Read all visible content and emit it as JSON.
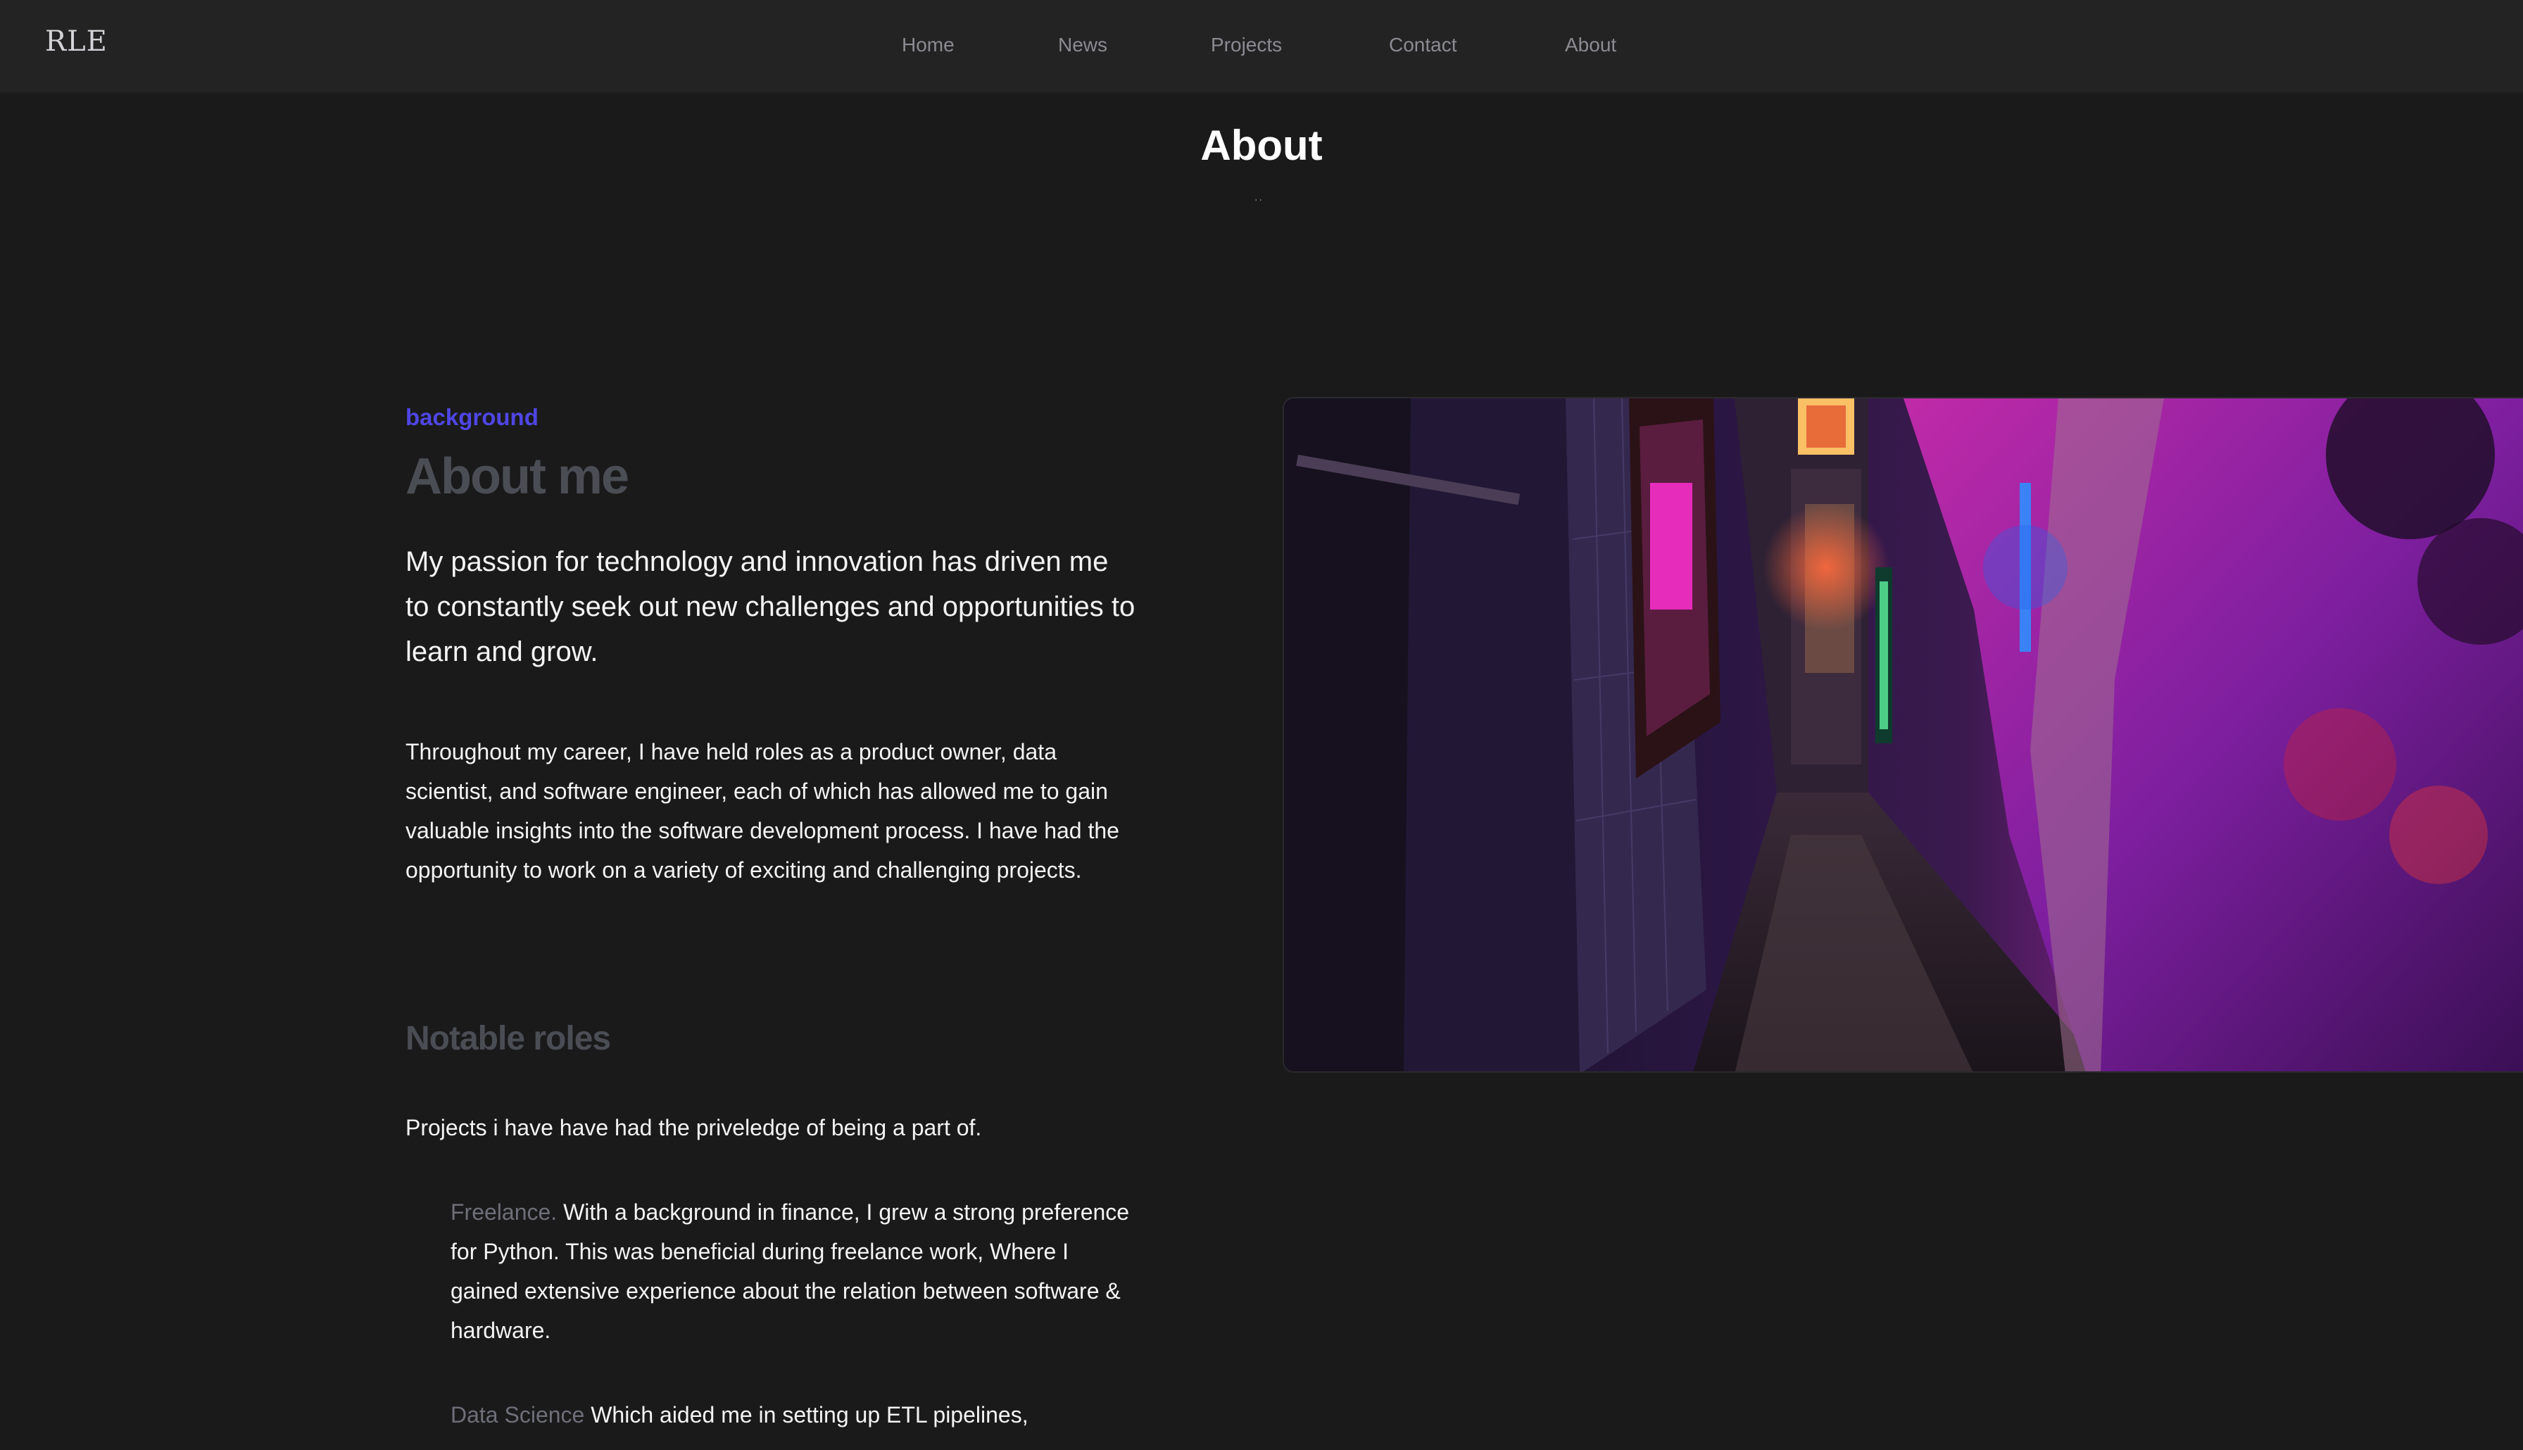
{
  "nav": {
    "brand": "RLE",
    "links": [
      "Home",
      "News",
      "Projects",
      "Contact",
      "About"
    ]
  },
  "page": {
    "title": "About",
    "dots": ".."
  },
  "about": {
    "eyebrow": "background",
    "heading": "About me",
    "lead": "My passion for technology and innovation has driven me to constantly seek out new challenges and opportunities to learn and grow.",
    "body": "Throughout my career, I have held roles as a product owner, data scientist, and software engineer, each of which has allowed me to gain valuable insights into the software development process. I have had the opportunity to work on a variety of exciting and challenging projects."
  },
  "roles": {
    "heading": "Notable roles",
    "intro": "Projects i have have had the priveledge of being a part of.",
    "items": [
      {
        "name": "Freelance.",
        "text": "With a background in finance, I grew a strong preference for Python. This was beneficial during freelance work, Where I gained extensive experience about the relation between software & hardware."
      },
      {
        "name": "Data Science",
        "text": "Which aided me in setting up ETL pipelines,"
      }
    ]
  },
  "image": {
    "subject": "neon-lit-alley-photo",
    "colors": {
      "purple": "#6b21a8",
      "magenta": "#d946ef",
      "blue": "#2563eb",
      "dark": "#14101f"
    }
  },
  "theme": {
    "background": "#1a1a1b",
    "navbar": "#232324",
    "accent": "#4f46e5",
    "muted_heading": "#4b4d55",
    "nav_text": "#8b8b92"
  }
}
